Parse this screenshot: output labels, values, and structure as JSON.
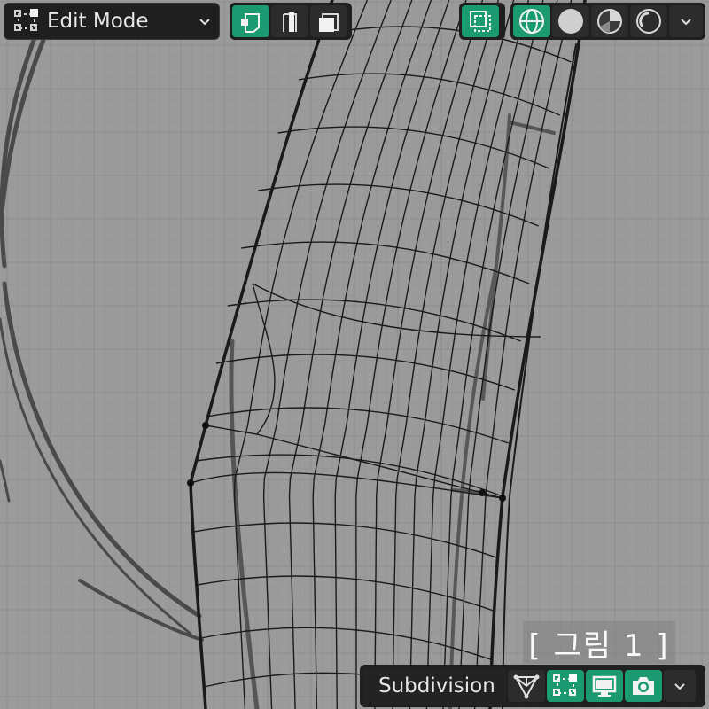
{
  "header": {
    "mode_label": "Edit Mode",
    "mode_icon": "edit-mode-icon",
    "select_modes": [
      {
        "name": "vertex-select-icon",
        "active": true
      },
      {
        "name": "edge-select-icon",
        "active": false
      },
      {
        "name": "face-select-icon",
        "active": false
      }
    ],
    "xray_icon": "xray-toggle-icon",
    "shading_modes": [
      {
        "name": "wireframe-shading-icon",
        "active": true
      },
      {
        "name": "solid-shading-icon",
        "active": false
      },
      {
        "name": "material-preview-icon",
        "active": false
      },
      {
        "name": "rendered-shading-icon",
        "active": false
      }
    ]
  },
  "modifier": {
    "name": "Subdivision",
    "toggles": [
      {
        "name": "on-cage-icon",
        "active": false
      },
      {
        "name": "edit-mode-display-icon",
        "active": true
      },
      {
        "name": "realtime-display-icon",
        "active": true
      },
      {
        "name": "render-display-icon",
        "active": true
      }
    ]
  },
  "caption": "[ 그림 1 ]",
  "colors": {
    "accent": "#1b9a72",
    "toolbar_bg": "#1f1f1f",
    "viewport_bg": "#9b9b9b",
    "grid": "#8a8a8a",
    "wire": "#1a1a1a"
  }
}
